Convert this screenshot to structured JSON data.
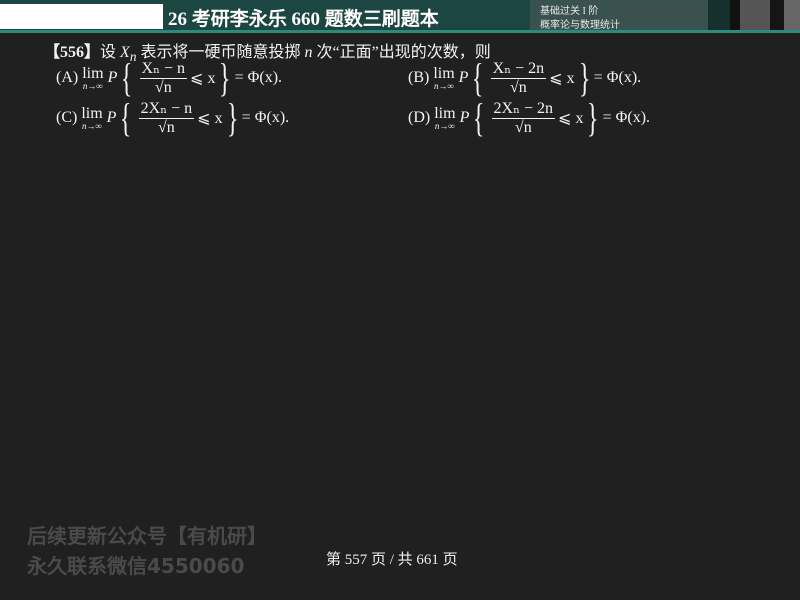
{
  "header": {
    "title": "26 考研李永乐 660 题数三刷题本",
    "section": "基础过关 I 阶",
    "subject": "概率论与数理统计"
  },
  "question": {
    "number": "【556】",
    "stem_prefix": "设 ",
    "var": "X",
    "var_sub": "n",
    "stem_mid": " 表示将一硬币随意投掷 ",
    "n": "n",
    "stem_suffix": " 次“正面”出现的次数，则",
    "options": [
      {
        "label": "(A)",
        "lim": "lim",
        "lim_sub": "n→∞",
        "P": "P",
        "numerator": "Xₙ − n",
        "denominator": "√n",
        "rhs": "⩽ x",
        "result": "= Φ(x)."
      },
      {
        "label": "(B)",
        "lim": "lim",
        "lim_sub": "n→∞",
        "P": "P",
        "numerator": "Xₙ − 2n",
        "denominator": "√n",
        "rhs": "⩽ x",
        "result": "= Φ(x)."
      },
      {
        "label": "(C)",
        "lim": "lim",
        "lim_sub": "n→∞",
        "P": "P",
        "numerator": "2Xₙ − n",
        "denominator": "√n",
        "rhs": "⩽ x",
        "result": "= Φ(x)."
      },
      {
        "label": "(D)",
        "lim": "lim",
        "lim_sub": "n→∞",
        "P": "P",
        "numerator": "2Xₙ − 2n",
        "denominator": "√n",
        "rhs": "⩽ x",
        "result": "= Φ(x)."
      }
    ]
  },
  "watermark": {
    "line1": "后续更新公众号【有机研】",
    "line2": "永久联系微信4550060"
  },
  "footer": {
    "page": "第 557 页 / 共 661 页"
  }
}
